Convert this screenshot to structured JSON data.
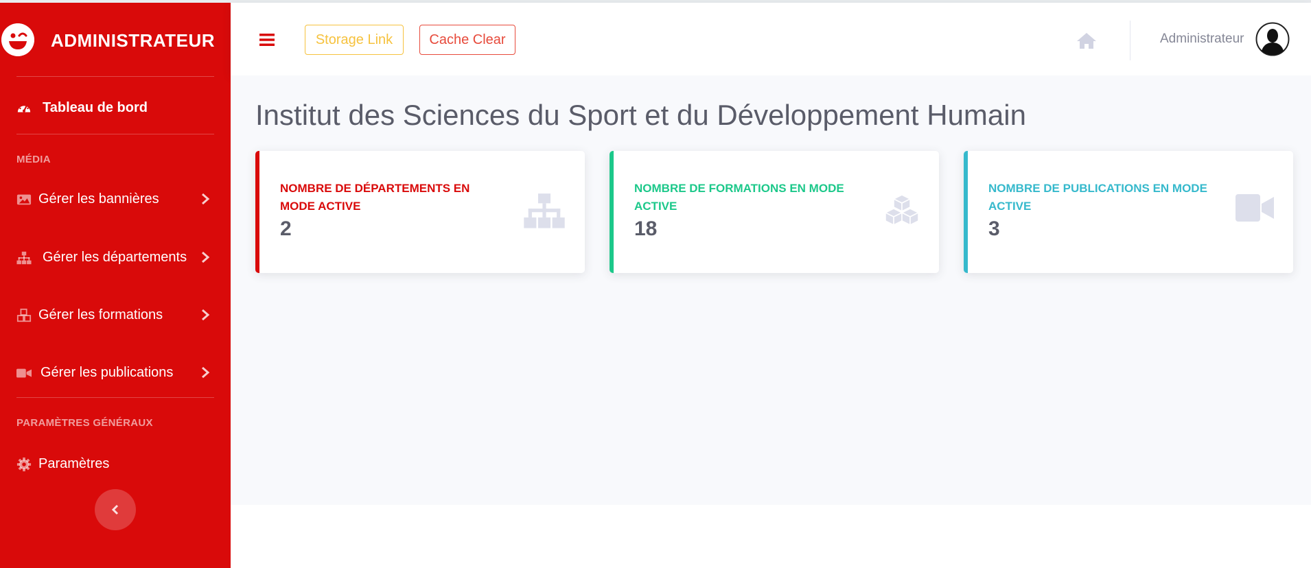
{
  "brand": {
    "title": "ADMINISTRATEUR"
  },
  "sidebar": {
    "dashboard": {
      "label": "Tableau de bord",
      "icon": "tachometer-icon"
    },
    "media_heading": "MÉDIA",
    "items": [
      {
        "label": "Gérer les bannières",
        "icon": "image-icon"
      },
      {
        "label": "Gérer les départements",
        "icon": "sitemap-icon"
      },
      {
        "label": "Gérer les formations",
        "icon": "cubes-icon"
      },
      {
        "label": "Gérer les publications",
        "icon": "video-icon"
      }
    ],
    "settings_heading": "PARAMÈTRES GÉNÉRAUX",
    "settings": {
      "label": "Paramètres",
      "icon": "gear-icon"
    }
  },
  "topbar": {
    "storage_link": "Storage Link",
    "cache_clear": "Cache Clear",
    "user_name": "Administrateur"
  },
  "main": {
    "title": "Institut des Sciences du Sport et du Développement Humain",
    "cards": [
      {
        "title": "NOMBRE DE DÉPARTEMENTS EN MODE ACTIVE",
        "value": "2",
        "color": "#d90a0a",
        "icon": "sitemap-icon"
      },
      {
        "title": "NOMBRE DE FORMATIONS EN MODE ACTIVE",
        "value": "18",
        "color": "#1cc88a",
        "icon": "cubes-icon"
      },
      {
        "title": "NOMBRE DE PUBLICATIONS EN MODE ACTIVE",
        "value": "3",
        "color": "#36b9cc",
        "icon": "video-icon"
      }
    ]
  },
  "colors": {
    "sidebar": "#d90a0a",
    "warning": "#f6c23e",
    "danger": "#e74a3b",
    "success": "#1cc88a",
    "info": "#36b9cc"
  }
}
